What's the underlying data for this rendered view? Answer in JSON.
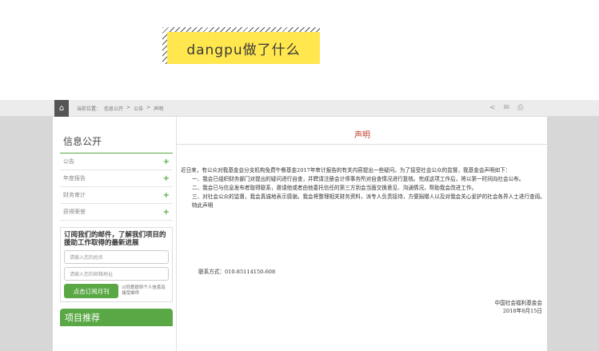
{
  "banner": {
    "text": "dangpu做了什么"
  },
  "breadcrumb": {
    "prefix": "当前位置：",
    "items": [
      "信息公开",
      ">",
      "公告",
      ">",
      "声明"
    ]
  },
  "share": {
    "share_icon": "share-icon",
    "mail_icon": "mail-icon",
    "print_icon": "print-icon"
  },
  "sidebar": {
    "title": "信息公开",
    "items": [
      {
        "label": "公告",
        "plus": "+"
      },
      {
        "label": "年度报告",
        "plus": "+"
      },
      {
        "label": "财务审计",
        "plus": "+"
      },
      {
        "label": "获得荣誉",
        "plus": "+"
      }
    ],
    "subscribe": {
      "title": "订阅我们的邮件，了解我们项目的援助工作取得的最新进展",
      "name_placeholder": "请输入您的姓名",
      "email_placeholder": "请输入您的邮箱地址",
      "button": "点击订阅月刊",
      "consent": "☑同意提供个人信息及接受邮件"
    },
    "projects_title": "项目推荐"
  },
  "article": {
    "title": "声明",
    "paragraphs": [
      "近日来，有公众对我基金会分支机构免费午餐基金2017年审计报告的有关内容提出一些疑问。为了接受社会公众的监督，我基金会声明如下：",
      "一、我会已组织财务部门对提出的疑问进行自查，并聘请注册会计师事务所对自查情况进行复核。完成这项工作后，将以第一时间向社会公布。",
      "二、我会已与信息发布者取得联系，邀请他或者由他委托信任的第三方到会当面交换意见、沟通情况，帮助我会改进工作。",
      "三、对社会公众的监督，我会真诚地表示感谢。我会将整理相关财务资料，派专人负责接待，方便捐赠人以及对我会关心爱护的社会各界人士进行查阅。",
      "特此声明"
    ],
    "contact": "联系方式：010-85114150-608",
    "org": "中国社会福利基金会",
    "date": "2018年8月15日"
  }
}
